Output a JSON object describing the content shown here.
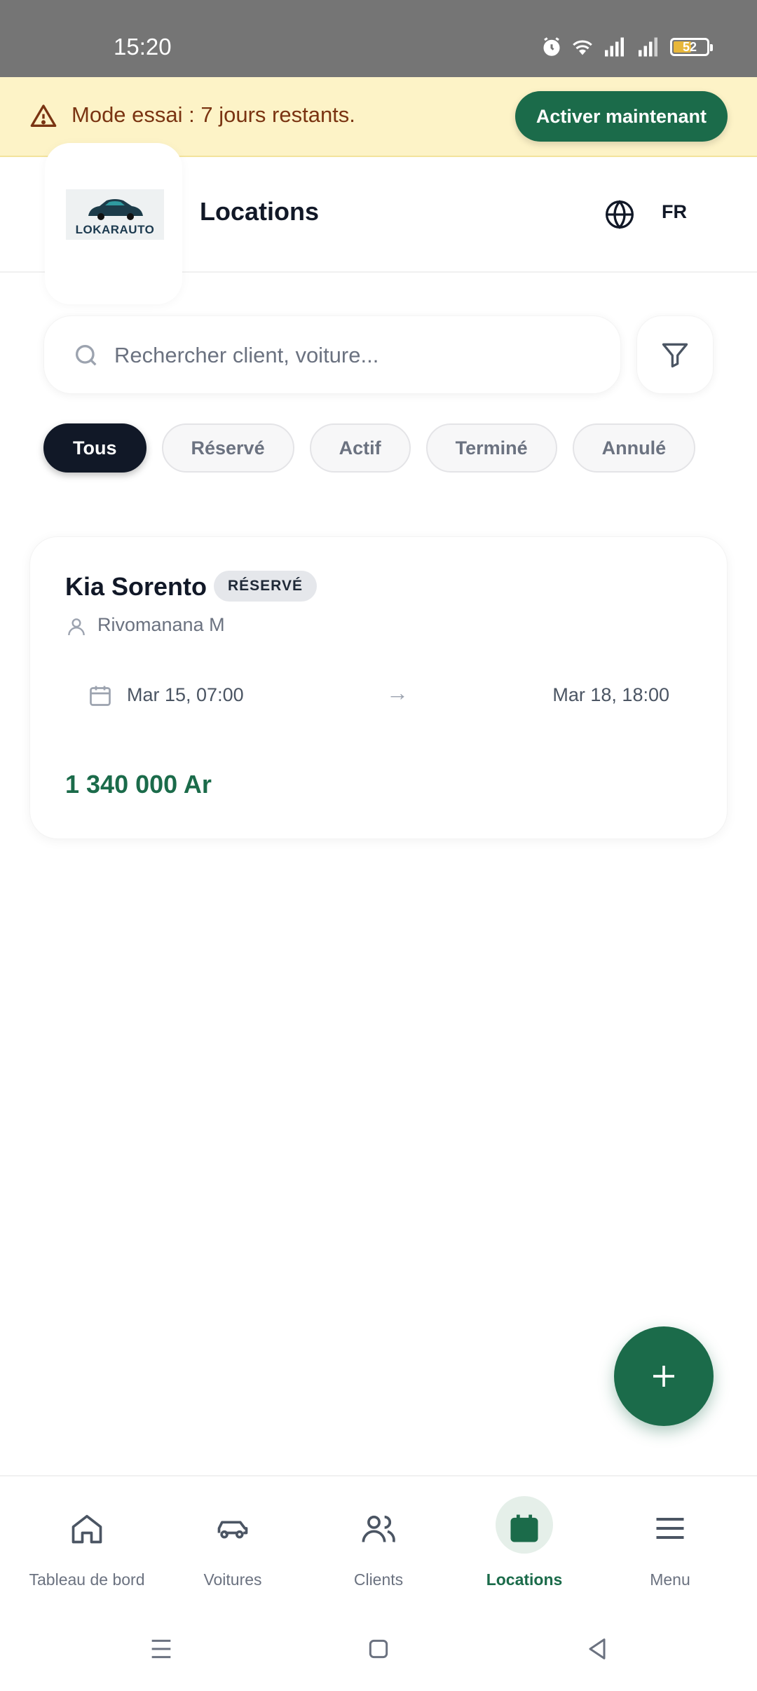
{
  "status_bar": {
    "time": "15:20",
    "battery": "52"
  },
  "banner": {
    "message": "Mode essai : 7 jours restants.",
    "action_label": "Activer maintenant"
  },
  "header": {
    "logo_text": "LOKARAUTO",
    "title": "Locations",
    "language": "FR"
  },
  "search": {
    "placeholder": "Rechercher client, voiture..."
  },
  "filters": [
    "Tous",
    "Réservé",
    "Actif",
    "Terminé",
    "Annulé"
  ],
  "selected_filter": "Tous",
  "rental": {
    "car": "Kia Sorento",
    "status": "RÉSERVÉ",
    "client": "Rivomanana M",
    "start": "Mar 15, 07:00",
    "arrow": "→",
    "end": "Mar 18, 18:00",
    "price": "1 340 000 Ar"
  },
  "nav": {
    "items": [
      {
        "label": "Tableau de bord",
        "icon": "home-icon"
      },
      {
        "label": "Voitures",
        "icon": "car-icon"
      },
      {
        "label": "Clients",
        "icon": "users-icon"
      },
      {
        "label": "Locations",
        "icon": "calendar-icon"
      },
      {
        "label": "Menu",
        "icon": "menu-icon"
      }
    ],
    "active": "Locations"
  },
  "colors": {
    "brand": "#1b6b4a",
    "banner_bg": "#fdf3c7",
    "banner_text": "#7a3412",
    "chip_active": "#111827"
  }
}
